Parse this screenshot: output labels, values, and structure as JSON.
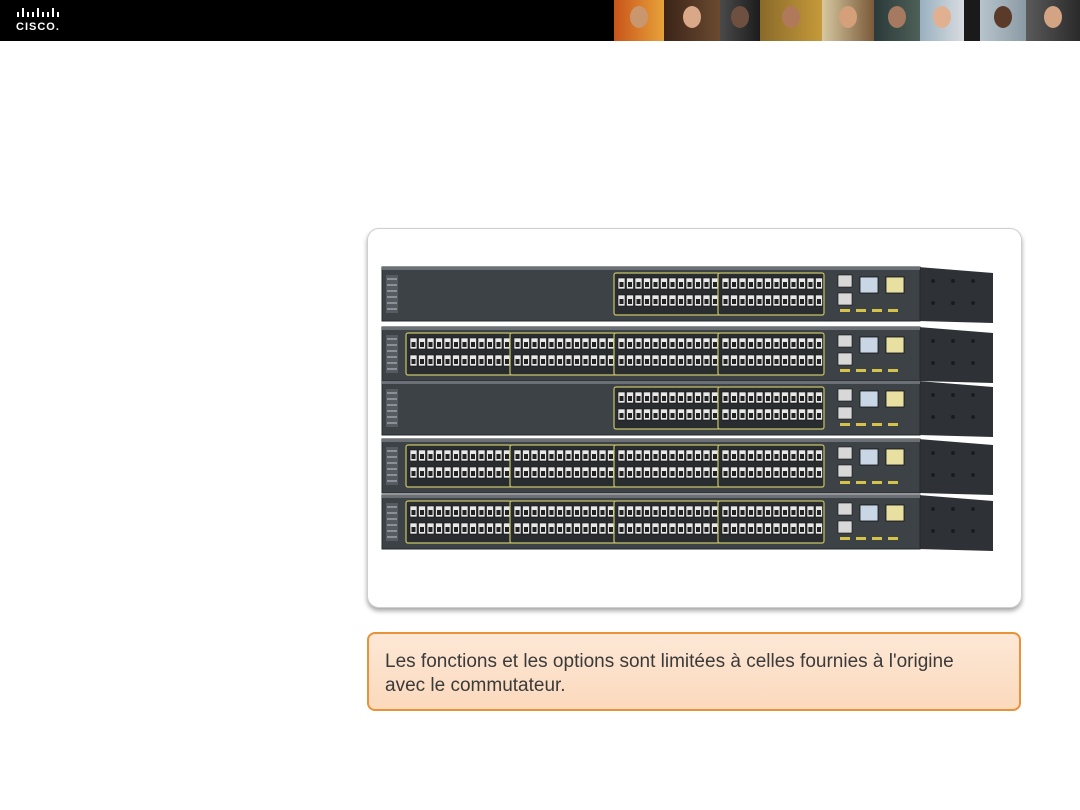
{
  "header": {
    "logo_text": "CISCO.",
    "logo_icon": "cisco-bridge-bars"
  },
  "image": {
    "subject": "stacked-network-switches"
  },
  "caption": {
    "text": "Les fonctions et les options sont limitées à celles fournies à l'origine avec le commutateur."
  },
  "colors": {
    "header_bg": "#000000",
    "caption_border": "#e8923a",
    "caption_bg": "#fde8d6",
    "switch_body": "#3d4247",
    "port_accent": "#c8c46a"
  }
}
